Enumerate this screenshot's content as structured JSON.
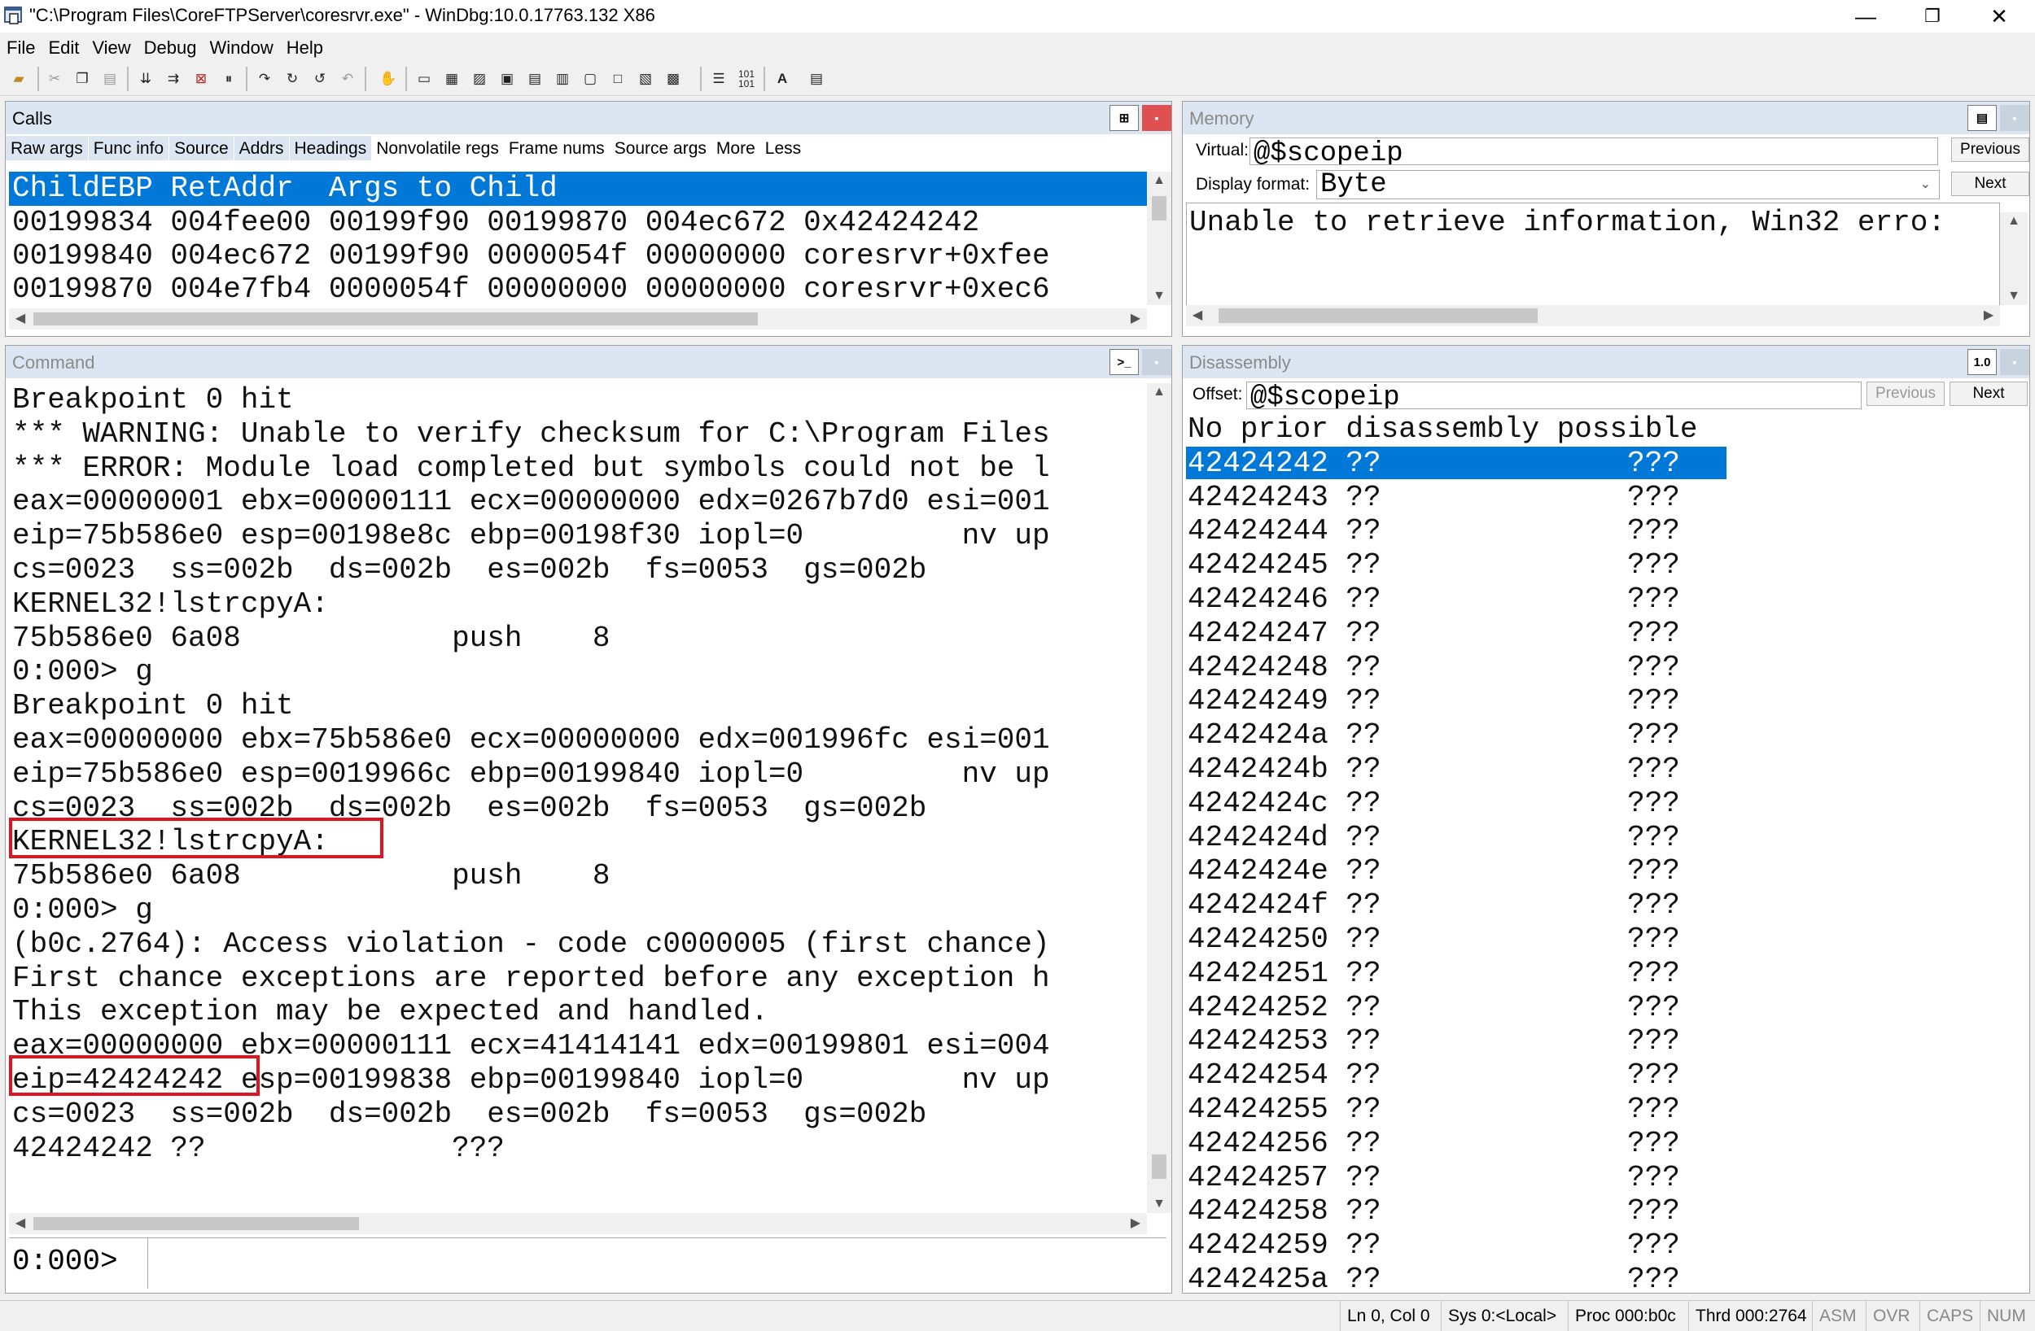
{
  "window": {
    "title": "\"C:\\Program Files\\CoreFTPServer\\coresrvr.exe\" - WinDbg:10.0.17763.132 X86",
    "minimize": "—",
    "restore": "❐",
    "close": "✕"
  },
  "menu": [
    "File",
    "Edit",
    "View",
    "Debug",
    "Window",
    "Help"
  ],
  "calls": {
    "title": "Calls",
    "tabs": [
      "Raw args",
      "Func info",
      "Source",
      "Addrs",
      "Headings",
      "Nonvolatile regs",
      "Frame nums",
      "Source args",
      "More",
      "Less"
    ],
    "header": "ChildEBP RetAddr  Args to Child",
    "rows": [
      "00199834 004fee00 00199f90 00199870 004ec672 0x42424242",
      "00199840 004ec672 00199f90 0000054f 00000000 coresrvr+0xfee",
      "00199870 004e7fb4 0000054f 00000000 00000000 coresrvr+0xec6"
    ]
  },
  "memory": {
    "title": "Memory",
    "virtual_label": "Virtual:",
    "virtual_value": "@$scopeip",
    "previous": "Previous",
    "next": "Next",
    "format_label": "Display format:",
    "format_value": "Byte",
    "content": "Unable to retrieve information, Win32 erro:"
  },
  "command": {
    "title": "Command",
    "lines": [
      "Breakpoint 0 hit",
      "*** WARNING: Unable to verify checksum for C:\\Program Files",
      "*** ERROR: Module load completed but symbols could not be l",
      "eax=00000001 ebx=00000111 ecx=00000000 edx=0267b7d0 esi=001",
      "eip=75b586e0 esp=00198e8c ebp=00198f30 iopl=0         nv up",
      "cs=0023  ss=002b  ds=002b  es=002b  fs=0053  gs=002b",
      "KERNEL32!lstrcpyA:",
      "75b586e0 6a08            push    8",
      "0:000> g",
      "Breakpoint 0 hit",
      "eax=00000000 ebx=75b586e0 ecx=00000000 edx=001996fc esi=001",
      "eip=75b586e0 esp=0019966c ebp=00199840 iopl=0         nv up",
      "cs=0023  ss=002b  ds=002b  es=002b  fs=0053  gs=002b",
      "KERNEL32!lstrcpyA:",
      "75b586e0 6a08            push    8",
      "0:000> g",
      "(b0c.2764): Access violation - code c0000005 (first chance)",
      "First chance exceptions are reported before any exception h",
      "This exception may be expected and handled.",
      "eax=00000000 ebx=00000111 ecx=41414141 edx=00199801 esi=004",
      "eip=42424242 esp=00199838 ebp=00199840 iopl=0         nv up",
      "cs=0023  ss=002b  ds=002b  es=002b  fs=0053  gs=002b",
      "42424242 ??              ???"
    ],
    "prompt": "0:000>"
  },
  "disassembly": {
    "title": "Disassembly",
    "offset_label": "Offset:",
    "offset_value": "@$scopeip",
    "previous": "Previous",
    "next": "Next",
    "header": "No prior disassembly possible",
    "rows": [
      "42424242 ??              ???",
      "42424243 ??              ???",
      "42424244 ??              ???",
      "42424245 ??              ???",
      "42424246 ??              ???",
      "42424247 ??              ???",
      "42424248 ??              ???",
      "42424249 ??              ???",
      "4242424a ??              ???",
      "4242424b ??              ???",
      "4242424c ??              ???",
      "4242424d ??              ???",
      "4242424e ??              ???",
      "4242424f ??              ???",
      "42424250 ??              ???",
      "42424251 ??              ???",
      "42424252 ??              ???",
      "42424253 ??              ???",
      "42424254 ??              ???",
      "42424255 ??              ???",
      "42424256 ??              ???",
      "42424257 ??              ???",
      "42424258 ??              ???",
      "42424259 ??              ???",
      "4242425a ??              ???"
    ]
  },
  "status": {
    "position": "Ln 0, Col 0",
    "sys": "Sys 0:<Local>",
    "proc": "Proc 000:b0c",
    "thread": "Thrd 000:2764",
    "asm": "ASM",
    "ovr": "OVR",
    "caps": "CAPS",
    "num": "NUM"
  },
  "colors": {
    "selection": "#0078d7",
    "panel_header": "#dce6f2",
    "highlight_box": "#e0141e"
  }
}
